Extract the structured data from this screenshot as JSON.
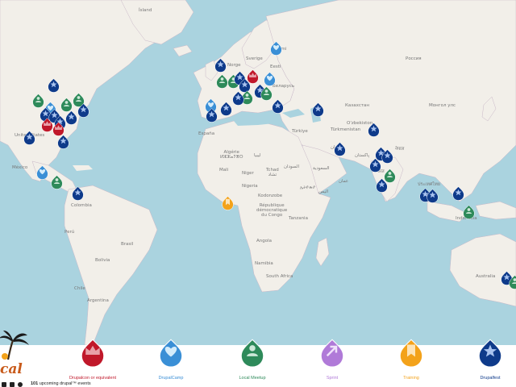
{
  "map": {
    "labels": {
      "island": "Ísland",
      "sverige": "Sverige",
      "suomi": "Suomi",
      "norge": "Norge",
      "eesti": "Eesti",
      "belarus": "Беларусь",
      "rossiya": "Россия",
      "kazakhstan": "Казахстан",
      "ozbekiston": "O'zbekiston",
      "turkmenistan": "Türkmenistan",
      "mongolia": "Монгол улс",
      "turkiye": "Türkiye",
      "iran": "ایران",
      "pakistan": "پاکستان",
      "nepal": "नेपाल",
      "espana": "España",
      "algeria": "Algérie\nⵍⵣⵣⴰⵢⴻⵔ",
      "libya": "ليبيا",
      "mali": "Mali",
      "niger": "Niger",
      "chad": "Tchad\nتشاد",
      "sudan": "السودان",
      "nigeria": "Nigeria",
      "ethiopia": "ኢትዮጵያ",
      "cameroon": "Kodonzobe",
      "congo": "République\ndémocratique\ndu Congo",
      "tanzania": "Tanzania",
      "angola": "Angola",
      "namibia": "Namibia",
      "south_africa": "South Africa",
      "united_states": "United States",
      "mexico": "México",
      "colombia": "Colombia",
      "peru": "Perú",
      "brasil": "Brasil",
      "bolivia": "Bolivia",
      "argentina": "Argentina",
      "chile": "Chile",
      "india": "भारत",
      "thailand": "ประเทศไทย",
      "indonesia": "Indonesia",
      "australia": "Australia",
      "oman": "عمان",
      "saudi": "السعودية",
      "yemen": "اليمن"
    }
  },
  "legend": {
    "items": [
      {
        "label": "Drupalcon or equivalent",
        "color": "#c0182a",
        "icon": "crown-icon",
        "text_color": "#c0182a"
      },
      {
        "label": "DrupalCamp",
        "color": "#3a8fd6",
        "icon": "heart-icon",
        "text_color": "#3a8fd6"
      },
      {
        "label": "Local Meetup",
        "color": "#2e8a5a",
        "icon": "person-icon",
        "text_color": "#2e8a5a"
      },
      {
        "label": "Sprint",
        "color": "#b07ad8",
        "icon": "arrow-icon",
        "text_color": "#b07ad8"
      },
      {
        "label": "Training",
        "color": "#f3a21a",
        "icon": "bookmark-icon",
        "text_color": "#f3a21a"
      },
      {
        "label": "Drupalfest",
        "color": "#0e3a8a",
        "icon": "star-icon",
        "text_color": "#0e3a8a"
      }
    ]
  },
  "footer": {
    "logo_text": "cal",
    "count_number": "101",
    "count_text": "upcoming drupal™ events"
  }
}
